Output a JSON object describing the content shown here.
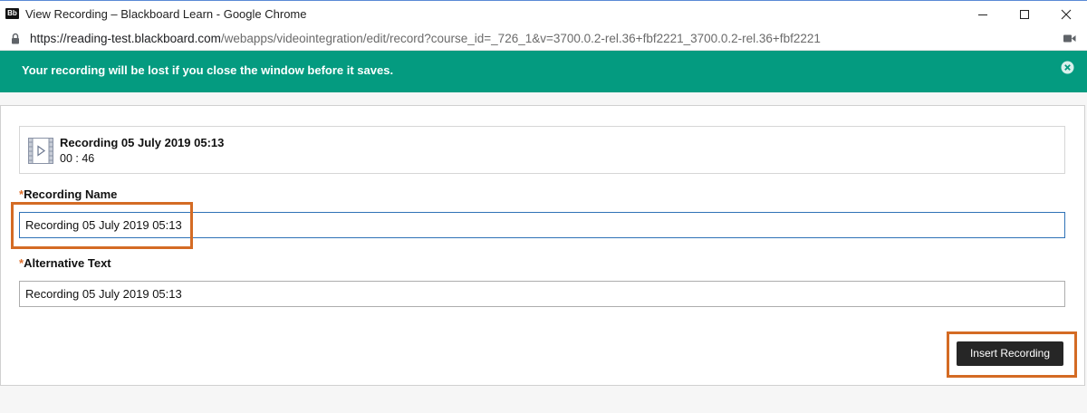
{
  "window": {
    "badge": "Bb",
    "title": "View Recording – Blackboard Learn - Google Chrome"
  },
  "address_bar": {
    "host": "https://reading-test.blackboard.com",
    "path": "/webapps/videointegration/edit/record?course_id=_726_1&v=3700.0.2-rel.36+fbf2221_3700.0.2-rel.36+fbf2221"
  },
  "banner": {
    "message": "Your recording will be lost if you close the window before it saves.",
    "color": "#049b80"
  },
  "recording": {
    "title": "Recording 05 July 2019 05:13",
    "duration": "00 : 46"
  },
  "form": {
    "required_marker": "*",
    "name_label": "Recording Name",
    "name_value": "Recording 05 July 2019 05:13",
    "alt_label": "Alternative Text",
    "alt_value": "Recording 05 July 2019 05:13"
  },
  "actions": {
    "insert_label": "Insert Recording"
  },
  "colors": {
    "highlight": "#d46b24",
    "required": "#e0702c",
    "focus_border": "#2f72b6",
    "button_bg": "#262626"
  },
  "icons": [
    "blackboard-logo-icon",
    "minimize-icon",
    "maximize-icon",
    "close-icon",
    "lock-icon",
    "camera-icon",
    "banner-close-icon",
    "video-file-icon"
  ]
}
